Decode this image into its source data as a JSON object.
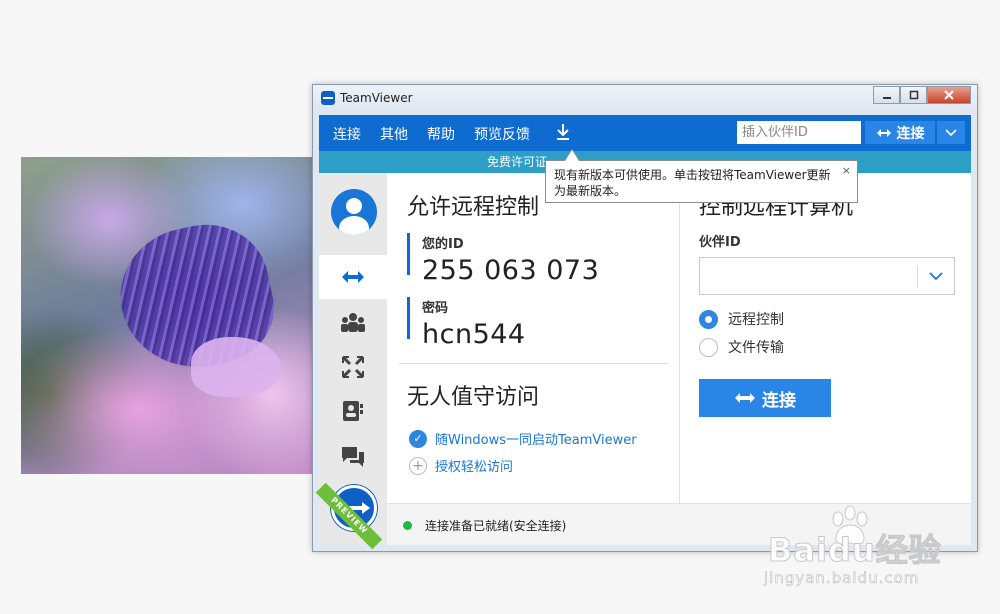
{
  "window": {
    "title": "TeamViewer"
  },
  "nav": {
    "items": [
      "连接",
      "其他",
      "帮助",
      "预览反馈"
    ],
    "download_icon": "download-icon",
    "partner_placeholder": "插入伙伴ID",
    "connect_label": "连接"
  },
  "license_bar": {
    "text": "免费许可证"
  },
  "tooltip": {
    "text": "现有新版本可供使用。单击按钮将TeamViewer更新为最新版本。",
    "close": "×"
  },
  "allow": {
    "heading": "允许远程控制",
    "id_label": "您的ID",
    "id_value": "255 063 073",
    "password_label": "密码",
    "password_value": "hcn544"
  },
  "unattended": {
    "heading": "无人值守访问",
    "start_with_windows": "随Windows一同启动TeamViewer",
    "grant_easy_access": "授权轻松访问"
  },
  "control": {
    "heading": "控制远程计算机",
    "partner_id_label": "伙伴ID",
    "partner_id_value": "",
    "options": [
      "远程控制",
      "文件传输"
    ],
    "selected": "远程控制",
    "connect_label": "连接"
  },
  "sidebar": {
    "items": [
      "remote-control-icon",
      "meeting-icon",
      "augmented-reality-icon",
      "contacts-icon",
      "chat-icon"
    ],
    "badge": "PREVIEW"
  },
  "status": {
    "text": "连接准备已就绪(安全连接)",
    "color": "#1fb84a"
  },
  "watermark": {
    "brand": "Baidu经验",
    "url": "jingyan.baidu.com"
  },
  "colors": {
    "accent": "#0e6bd0",
    "banner": "#2d9fc7",
    "button": "#2a86e6"
  }
}
